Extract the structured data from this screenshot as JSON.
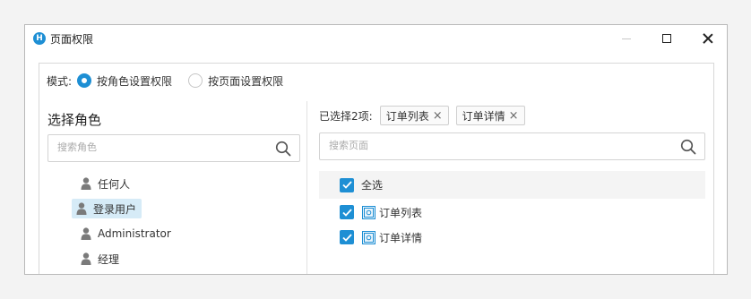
{
  "window": {
    "title": "页面权限",
    "app_icon_letter": "H",
    "accent_color": "#1e8fd4"
  },
  "mode": {
    "label": "模式:",
    "options": [
      {
        "label": "按角色设置权限",
        "selected": true
      },
      {
        "label": "按页面设置权限",
        "selected": false
      }
    ]
  },
  "roles": {
    "title": "选择角色",
    "search_placeholder": "搜索角色",
    "items": [
      {
        "label": "任何人",
        "selected": false
      },
      {
        "label": "登录用户",
        "selected": true
      },
      {
        "label": "Administrator",
        "selected": false
      },
      {
        "label": "经理",
        "selected": false
      }
    ]
  },
  "pages": {
    "selected_label": "已选择2项:",
    "tags": [
      "订单列表",
      "订单详情"
    ],
    "search_placeholder": "搜索页面",
    "select_all_label": "全选",
    "items": [
      {
        "label": "订单列表",
        "checked": true
      },
      {
        "label": "订单详情",
        "checked": true
      }
    ]
  }
}
